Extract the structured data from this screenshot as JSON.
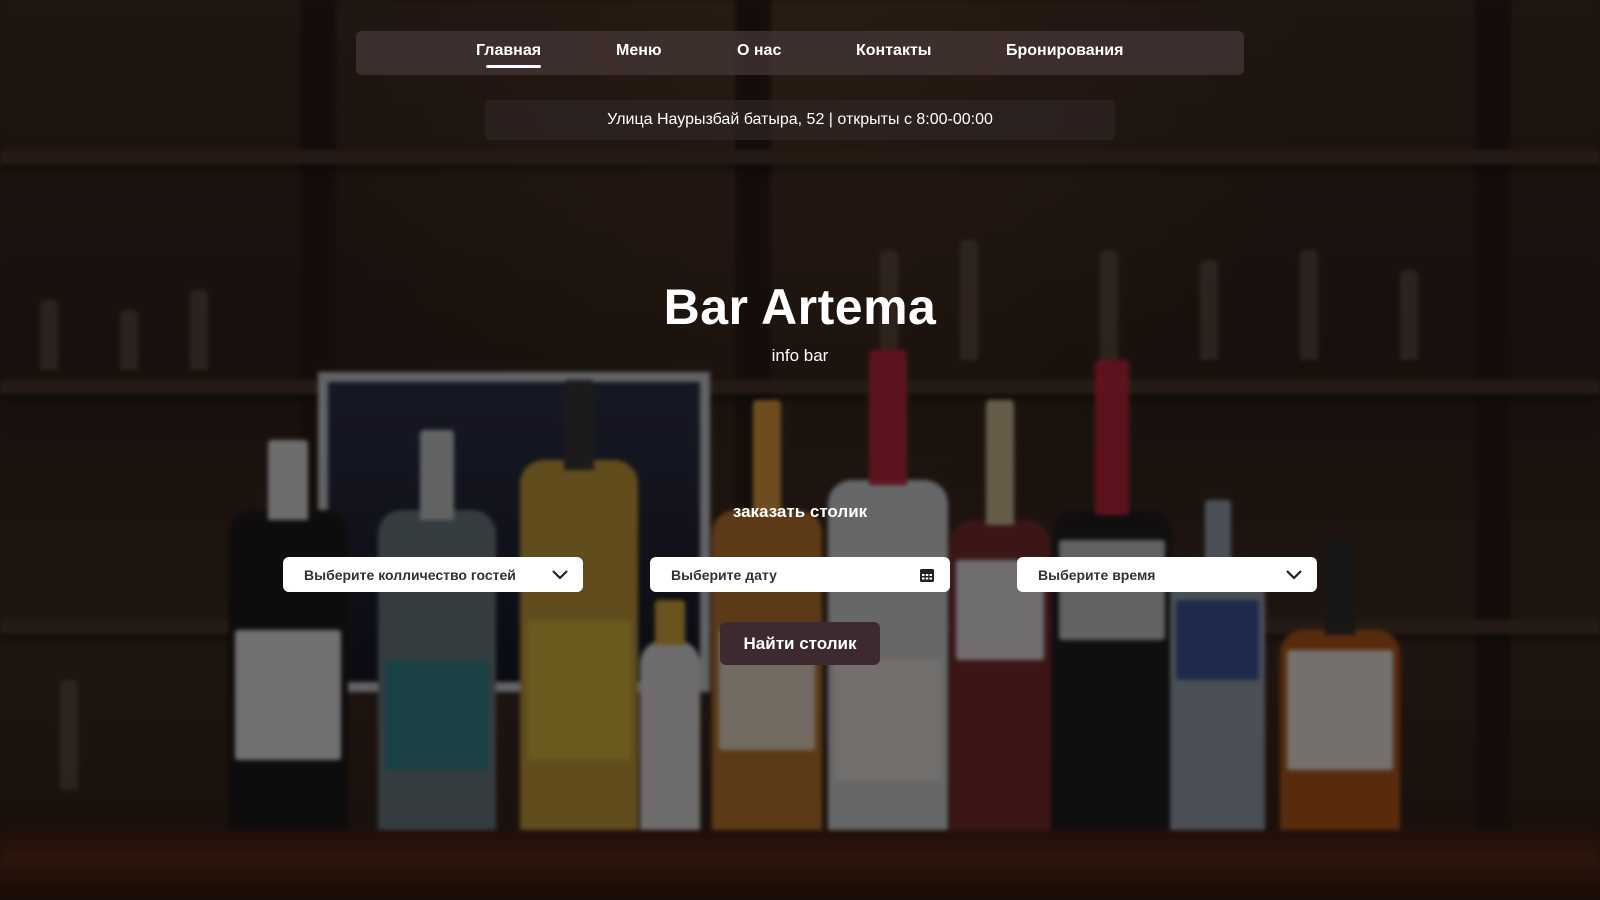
{
  "nav": {
    "items": [
      {
        "label": "Главная",
        "active": true
      },
      {
        "label": "Меню",
        "active": false
      },
      {
        "label": "О нас",
        "active": false
      },
      {
        "label": "Контакты",
        "active": false
      },
      {
        "label": "Бронирования",
        "active": false
      }
    ]
  },
  "info_bar": {
    "text": "Улица Наурызбай батыра, 52 | открыты с 8:00-00:00"
  },
  "hero": {
    "title": "Bar Artema",
    "subtitle": "info bar"
  },
  "booking": {
    "title": "заказать столик",
    "guests_placeholder": "Выберите колличество гостей",
    "date_placeholder": "Выберите дату",
    "time_placeholder": "Выберите время",
    "submit_label": "Найти столик"
  },
  "icons": {
    "guests": "chevron-down-icon",
    "date": "calendar-icon",
    "time": "chevron-down-icon"
  },
  "colors": {
    "nav_background": "#46373788",
    "button_background": "#3c2a30",
    "text": "#ffffff"
  }
}
